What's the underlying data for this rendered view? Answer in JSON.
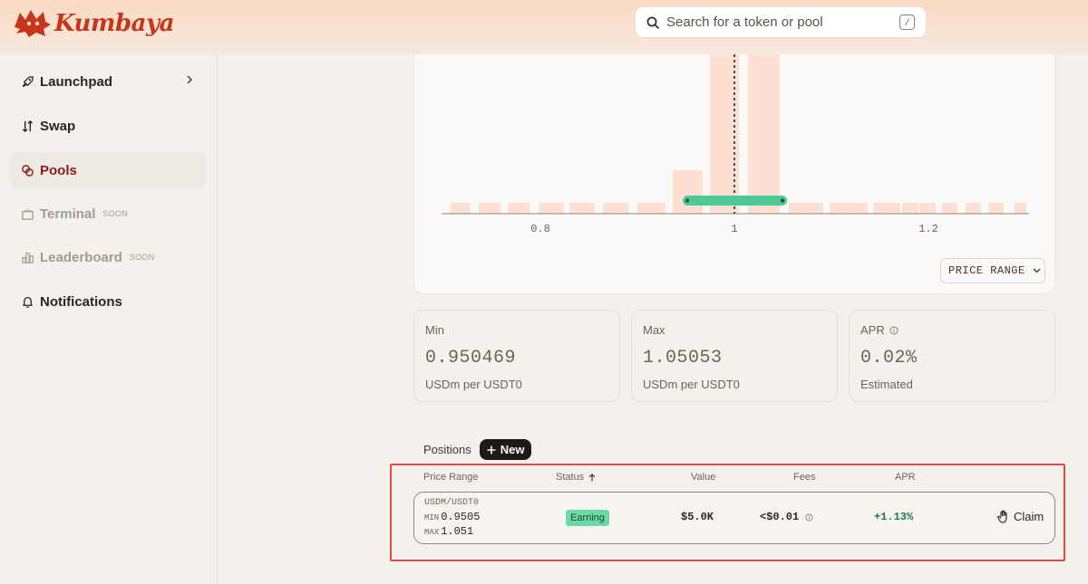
{
  "app": {
    "name": "Kumbaya"
  },
  "colors": {
    "brand": "#c7361b",
    "accent_green": "#4cc995",
    "bar_fill": "#fde0d1"
  },
  "search": {
    "placeholder": "Search for a token or pool",
    "shortcut": "/"
  },
  "sidebar": {
    "items": [
      {
        "label": "Launchpad",
        "icon": "rocket-icon",
        "state": "normal",
        "has_chevron": true
      },
      {
        "label": "Swap",
        "icon": "swap-arrows-icon",
        "state": "normal"
      },
      {
        "label": "Pools",
        "icon": "pools-icon",
        "state": "active"
      },
      {
        "label": "Terminal",
        "icon": "terminal-icon",
        "state": "disabled",
        "badge": "SOON"
      },
      {
        "label": "Leaderboard",
        "icon": "leaderboard-icon",
        "state": "disabled",
        "badge": "SOON"
      },
      {
        "label": "Notifications",
        "icon": "bell-icon",
        "state": "normal"
      }
    ]
  },
  "chart": {
    "tick_labels": [
      "0.8",
      "1",
      "1.2"
    ],
    "current_price": 1,
    "range_min": 0.950469,
    "range_max": 1.05053,
    "selector_label": "PRICE RANGE"
  },
  "stats": {
    "min": {
      "label": "Min",
      "value": "0.950469",
      "sub": "USDm per USDT0"
    },
    "max": {
      "label": "Max",
      "value": "1.05053",
      "sub": "USDm per USDT0"
    },
    "apr": {
      "label": "APR",
      "value": "0.02%",
      "sub": "Estimated"
    }
  },
  "positions": {
    "title": "Positions",
    "new_label": "New",
    "columns": {
      "price_range": "Price Range",
      "status": "Status",
      "value": "Value",
      "fees": "Fees",
      "apr": "APR"
    },
    "rows": [
      {
        "pair": "USDM/USDT0",
        "min_tag": "MIN",
        "min": "0.9505",
        "max_tag": "MAX",
        "max": "1.051",
        "status": "Earning",
        "value": "$5.0K",
        "fees": "<$0.01",
        "apr": "+1.13%",
        "action": "Claim"
      }
    ]
  }
}
